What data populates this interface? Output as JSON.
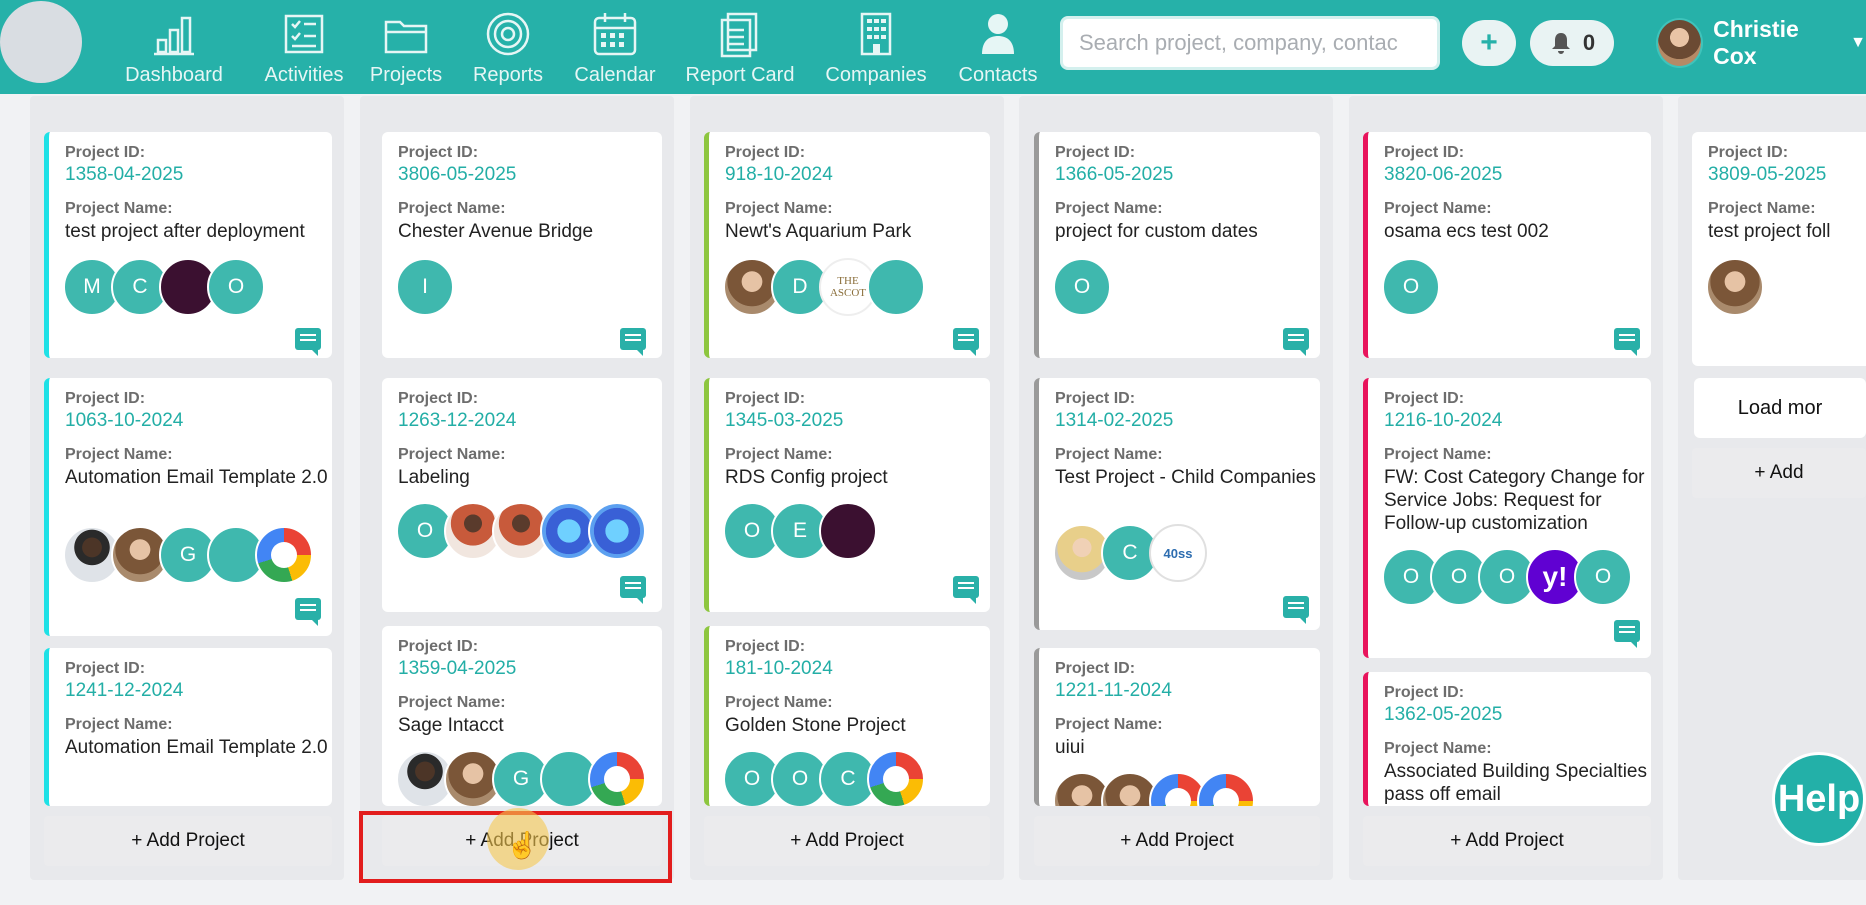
{
  "nav": {
    "items": [
      {
        "label": "Dashboard",
        "icon": "bar-chart-icon"
      },
      {
        "label": "Activities",
        "icon": "checklist-icon"
      },
      {
        "label": "Projects",
        "icon": "folder-icon"
      },
      {
        "label": "Reports",
        "icon": "target-icon"
      },
      {
        "label": "Calendar",
        "icon": "calendar-icon"
      },
      {
        "label": "Report Card",
        "icon": "document-icon"
      },
      {
        "label": "Companies",
        "icon": "building-icon"
      },
      {
        "label": "Contacts",
        "icon": "person-icon"
      }
    ],
    "search_placeholder": "Search project, company, contac",
    "add_label": "+",
    "notification_count": "0",
    "user_name": "Christie Cox"
  },
  "labels": {
    "project_id": "Project ID:",
    "project_name": "Project Name:",
    "add_project": "+ Add Project",
    "add_partial": "+ Add",
    "load_more": "Load mor",
    "help": "Help"
  },
  "columns": [
    {
      "cards": [
        {
          "id": "1358-04-2025",
          "name": "test project after deployment",
          "avatars": [
            "M",
            "C",
            "",
            "O"
          ]
        },
        {
          "id": "1063-10-2024",
          "name": "Automation Email Template 2.0",
          "avatars": [
            "",
            "",
            "G",
            "",
            ""
          ]
        },
        {
          "id": "1241-12-2024",
          "name": "Automation Email Template 2.0",
          "avatars": []
        }
      ]
    },
    {
      "cards": [
        {
          "id": "3806-05-2025",
          "name": "Chester Avenue Bridge",
          "avatars": [
            "I"
          ]
        },
        {
          "id": "1263-12-2024",
          "name": "Labeling",
          "avatars": [
            "O",
            "",
            "",
            "",
            ""
          ]
        },
        {
          "id": "1359-04-2025",
          "name": "Sage Intacct",
          "avatars": [
            "",
            "",
            "G",
            "",
            ""
          ]
        }
      ]
    },
    {
      "cards": [
        {
          "id": "918-10-2024",
          "name": "Newt's Aquarium Park",
          "avatars": [
            "",
            "D",
            "THE ASCOT",
            ""
          ]
        },
        {
          "id": "1345-03-2025",
          "name": "RDS Config project",
          "avatars": [
            "O",
            "E",
            ""
          ]
        },
        {
          "id": "181-10-2024",
          "name": "Golden Stone Project",
          "avatars": [
            "O",
            "O",
            "C",
            ""
          ]
        }
      ]
    },
    {
      "cards": [
        {
          "id": "1366-05-2025",
          "name": "project for custom dates",
          "avatars": [
            "O"
          ]
        },
        {
          "id": "1314-02-2025",
          "name": "Test Project - Child Companies",
          "avatars": [
            "",
            "C",
            "40ss"
          ]
        },
        {
          "id": "1221-11-2024",
          "name": "uiui",
          "avatars": []
        }
      ]
    },
    {
      "cards": [
        {
          "id": "3820-06-2025",
          "name": "osama ecs test 002",
          "avatars": [
            "O"
          ]
        },
        {
          "id": "1216-10-2024",
          "name": "FW: Cost Category Change for Service Jobs: Request for Follow-up customization",
          "avatars": [
            "O",
            "O",
            "O",
            "y!",
            "O"
          ]
        },
        {
          "id": "1362-05-2025",
          "name": "Associated Building Specialties pass off email",
          "avatars": []
        }
      ]
    },
    {
      "cards": [
        {
          "id": "3809-05-2025",
          "name": "test project foll",
          "avatars": [
            ""
          ]
        }
      ]
    }
  ]
}
